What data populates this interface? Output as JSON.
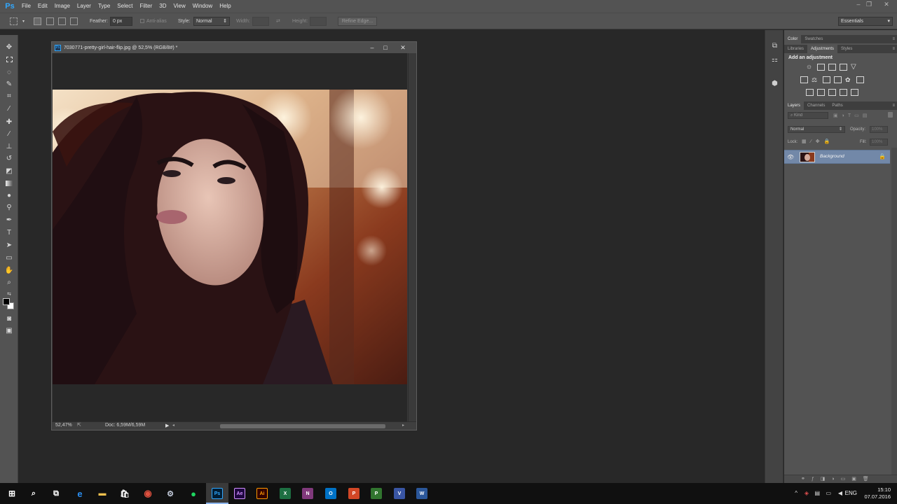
{
  "app": {
    "logo": "Ps",
    "menu": [
      "File",
      "Edit",
      "Image",
      "Layer",
      "Type",
      "Select",
      "Filter",
      "3D",
      "View",
      "Window",
      "Help"
    ],
    "window_controls": {
      "minimize": "–",
      "restore": "❐",
      "close": "✕"
    }
  },
  "options": {
    "feather_label": "Feather:",
    "feather_value": "0 px",
    "antialias_label": "Anti-alias",
    "style_label": "Style:",
    "style_value": "Normal",
    "width_label": "Width:",
    "height_label": "Height:",
    "refine_edge": "Refine Edge...",
    "workspace": "Essentials"
  },
  "document": {
    "title": "7030771-pretty-girl-hair-flip.jpg @ 52,5% (RGB/8#) *",
    "zoom": "52,47%",
    "doc_info": "Doc: 6,59M/6,59M"
  },
  "panels": {
    "color_tabs": [
      "Color",
      "Swatches"
    ],
    "adj_tabs": [
      "Libraries",
      "Adjustments",
      "Styles"
    ],
    "adj_title": "Add an adjustment",
    "layers_tabs": [
      "Layers",
      "Channels",
      "Paths"
    ],
    "kind_filter": "Kind",
    "blend_mode": "Normal",
    "opacity_label": "Opacity:",
    "opacity_value": "100%",
    "lock_label": "Lock:",
    "fill_label": "Fill:",
    "fill_value": "100%",
    "layer_name": "Background"
  },
  "icons": {
    "tools": [
      "move-icon",
      "marquee-icon",
      "lasso-icon",
      "quick-selection-icon",
      "crop-icon",
      "eyedropper-icon",
      "healing-brush-icon",
      "brush-icon",
      "clone-stamp-icon",
      "history-brush-icon",
      "eraser-icon",
      "gradient-icon",
      "blur-icon",
      "dodge-icon",
      "pen-icon",
      "type-icon",
      "path-selection-icon",
      "rectangle-icon",
      "hand-icon",
      "zoom-icon"
    ]
  },
  "taskbar": {
    "language": "ENG",
    "time": "15:10",
    "date": "07.07.2016",
    "apps": [
      "Ps",
      "Ae",
      "Ai",
      "X",
      "N",
      "O",
      "P",
      "P",
      "V",
      "W"
    ]
  }
}
